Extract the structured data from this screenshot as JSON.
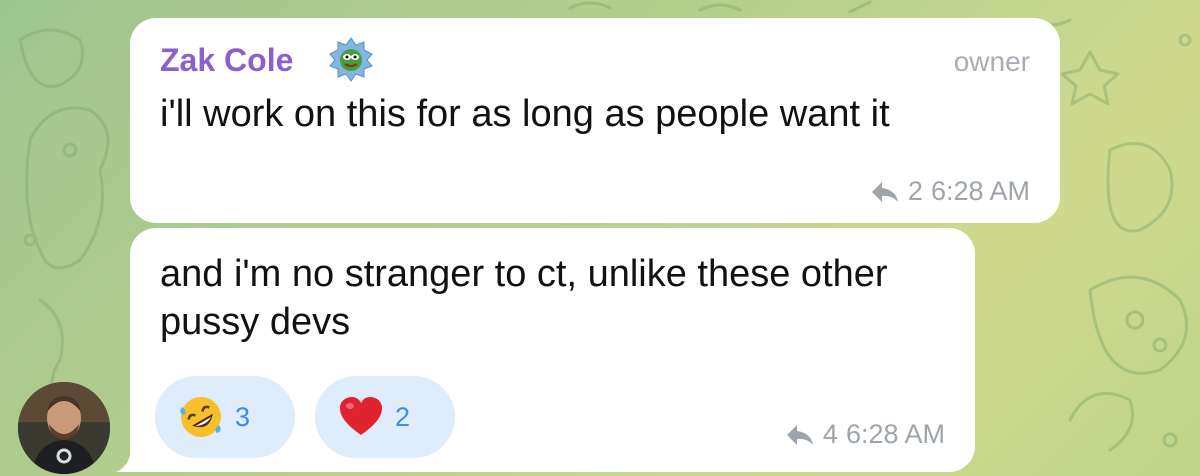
{
  "message1": {
    "sender": "Zak Cole",
    "role": "owner",
    "text": "i'll work on this for as long as people want it",
    "reply_count": "2",
    "time": "6:28 AM"
  },
  "message2": {
    "text": "and i'm no stranger to ct, unlike these other pussy devs",
    "reply_count": "4",
    "time": "6:28 AM",
    "reactions": [
      {
        "emoji": "rolling-on-floor-laughing-icon",
        "count": "3"
      },
      {
        "emoji": "red-heart-icon",
        "count": "2"
      }
    ]
  },
  "colors": {
    "sender": "#8b5fd0",
    "reaction_bg": "#dfecfb",
    "reaction_count": "#3d8ee0",
    "meta": "#9ea4ab"
  }
}
